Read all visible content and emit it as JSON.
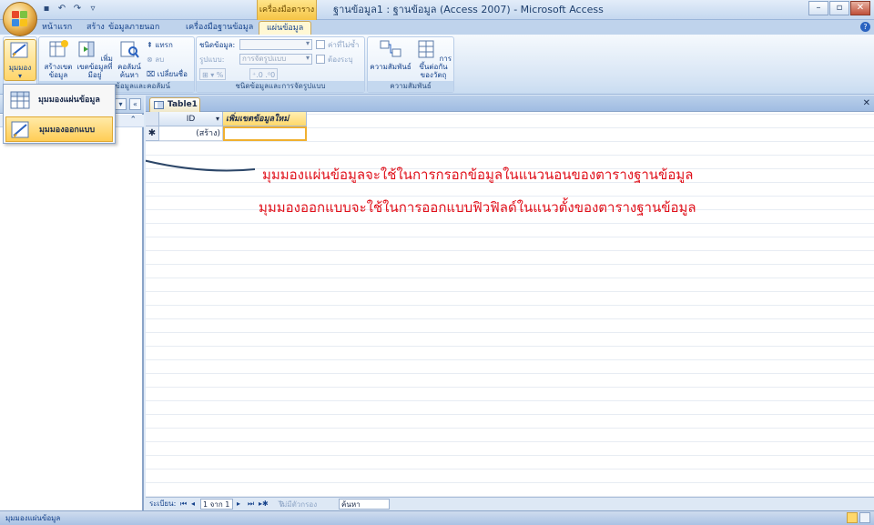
{
  "window": {
    "title": "ฐานข้อมูล1 : ฐานข้อมูล (Access 2007) - Microsoft Access",
    "context_tab_title": "เครื่องมือตาราง",
    "min": "–",
    "max": "▫",
    "close": "✕"
  },
  "tabs": [
    "หน้าแรก",
    "สร้าง",
    "ข้อมูลภายนอก",
    "เครื่องมือฐานข้อมูล",
    "แผ่นข้อมูล"
  ],
  "ribbon": {
    "views": {
      "label": "มุมมอง"
    },
    "fields": {
      "new_field": "สร้างเขตข้อมูล",
      "add_existing": "เพิ่มเขตข้อมูลที่มีอยู่",
      "lookup_column": "คอลัมน์ค้นหา",
      "insert": "แทรก",
      "delete": "ลบ",
      "rename": "เปลี่ยนชื่อ",
      "group_name": "เขตข้อมูลและคอลัมน์"
    },
    "format": {
      "data_type_label": "ชนิดข้อมูล:",
      "format_label": "รูปแบบ:",
      "format_value": "การจัดรูปแบบ",
      "unique": "ค่าที่ไม่ซ้ำ",
      "required": "ต้องระบุ",
      "group_name": "ชนิดข้อมูลและการจัดรูปแบบ"
    },
    "relationships": {
      "relationships": "ความสัมพันธ์",
      "object_dependencies": "การขึ้นต่อกันของวัตถุ",
      "group_name": "ความสัมพันธ์"
    }
  },
  "dropdown": {
    "datasheet_view": "มุมมองแผ่นข้อมูล",
    "design_view": "มุมมองออกแบบ"
  },
  "document": {
    "tab_label": "Table1",
    "columns": [
      "ID",
      "เพิ่มเขตข้อมูลใหม่"
    ],
    "new_row_marker": "✱",
    "new_row_value": "(สร้าง)"
  },
  "annotations": [
    "มุมมองแผ่นข้อมูลจะใช้ในการกรอกข้อมูลในแนวนอนของตารางฐานข้อมูล",
    "มุมมองออกแบบจะใช้ในการออกแบบฟิวฟิลด์ในแนวตั้งของตารางฐานข้อมูล"
  ],
  "record_nav": {
    "label": "ระเบียน:",
    "position": "1 จาก 1",
    "no_filter": "ไม่มีตัวกรอง",
    "search": "ค้นหา"
  },
  "status": {
    "text": "มุมมองแผ่นข้อมูล"
  }
}
